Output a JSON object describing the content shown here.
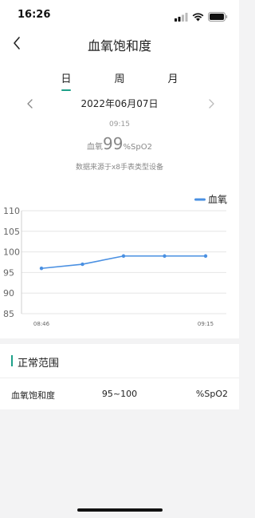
{
  "status_bar": {
    "time": "16:26",
    "icons": [
      "signal-icon",
      "wifi-icon",
      "battery-icon"
    ]
  },
  "nav": {
    "back_icon": "chevron-left-icon",
    "title": "血氧饱和度"
  },
  "tabs": [
    {
      "label": "日",
      "active": true
    },
    {
      "label": "周",
      "active": false
    },
    {
      "label": "月",
      "active": false
    }
  ],
  "date_nav": {
    "prev_icon": "chevron-left-icon",
    "date": "2022年06月07日",
    "next_icon": "chevron-right-icon"
  },
  "summary": {
    "time": "09:15",
    "prefix": "血氧",
    "value": "99",
    "unit": "%SpO2",
    "source": "数据来源于x8手表类型设备"
  },
  "colors": {
    "accent": "#1ea089",
    "line": "#4a90e2",
    "grid": "#e6e6e6",
    "axis_text": "#666666",
    "background": "#f3f3f4"
  },
  "chart_data": {
    "type": "line",
    "legend": "血氧",
    "legend_position": "top-right",
    "y_ticks": [
      "110",
      "105",
      "100",
      "95",
      "90",
      "85"
    ],
    "ylim": [
      85,
      110
    ],
    "x_labels": [
      "08:46",
      "09:15"
    ],
    "series": [
      {
        "name": "血氧",
        "values": [
          96,
          97,
          99,
          99,
          99
        ]
      }
    ],
    "grid": true
  },
  "normal_range": {
    "title": "正常范围",
    "rows": [
      {
        "name": "血氧饱和度",
        "range": "95~100",
        "unit": "%SpO2"
      }
    ]
  }
}
